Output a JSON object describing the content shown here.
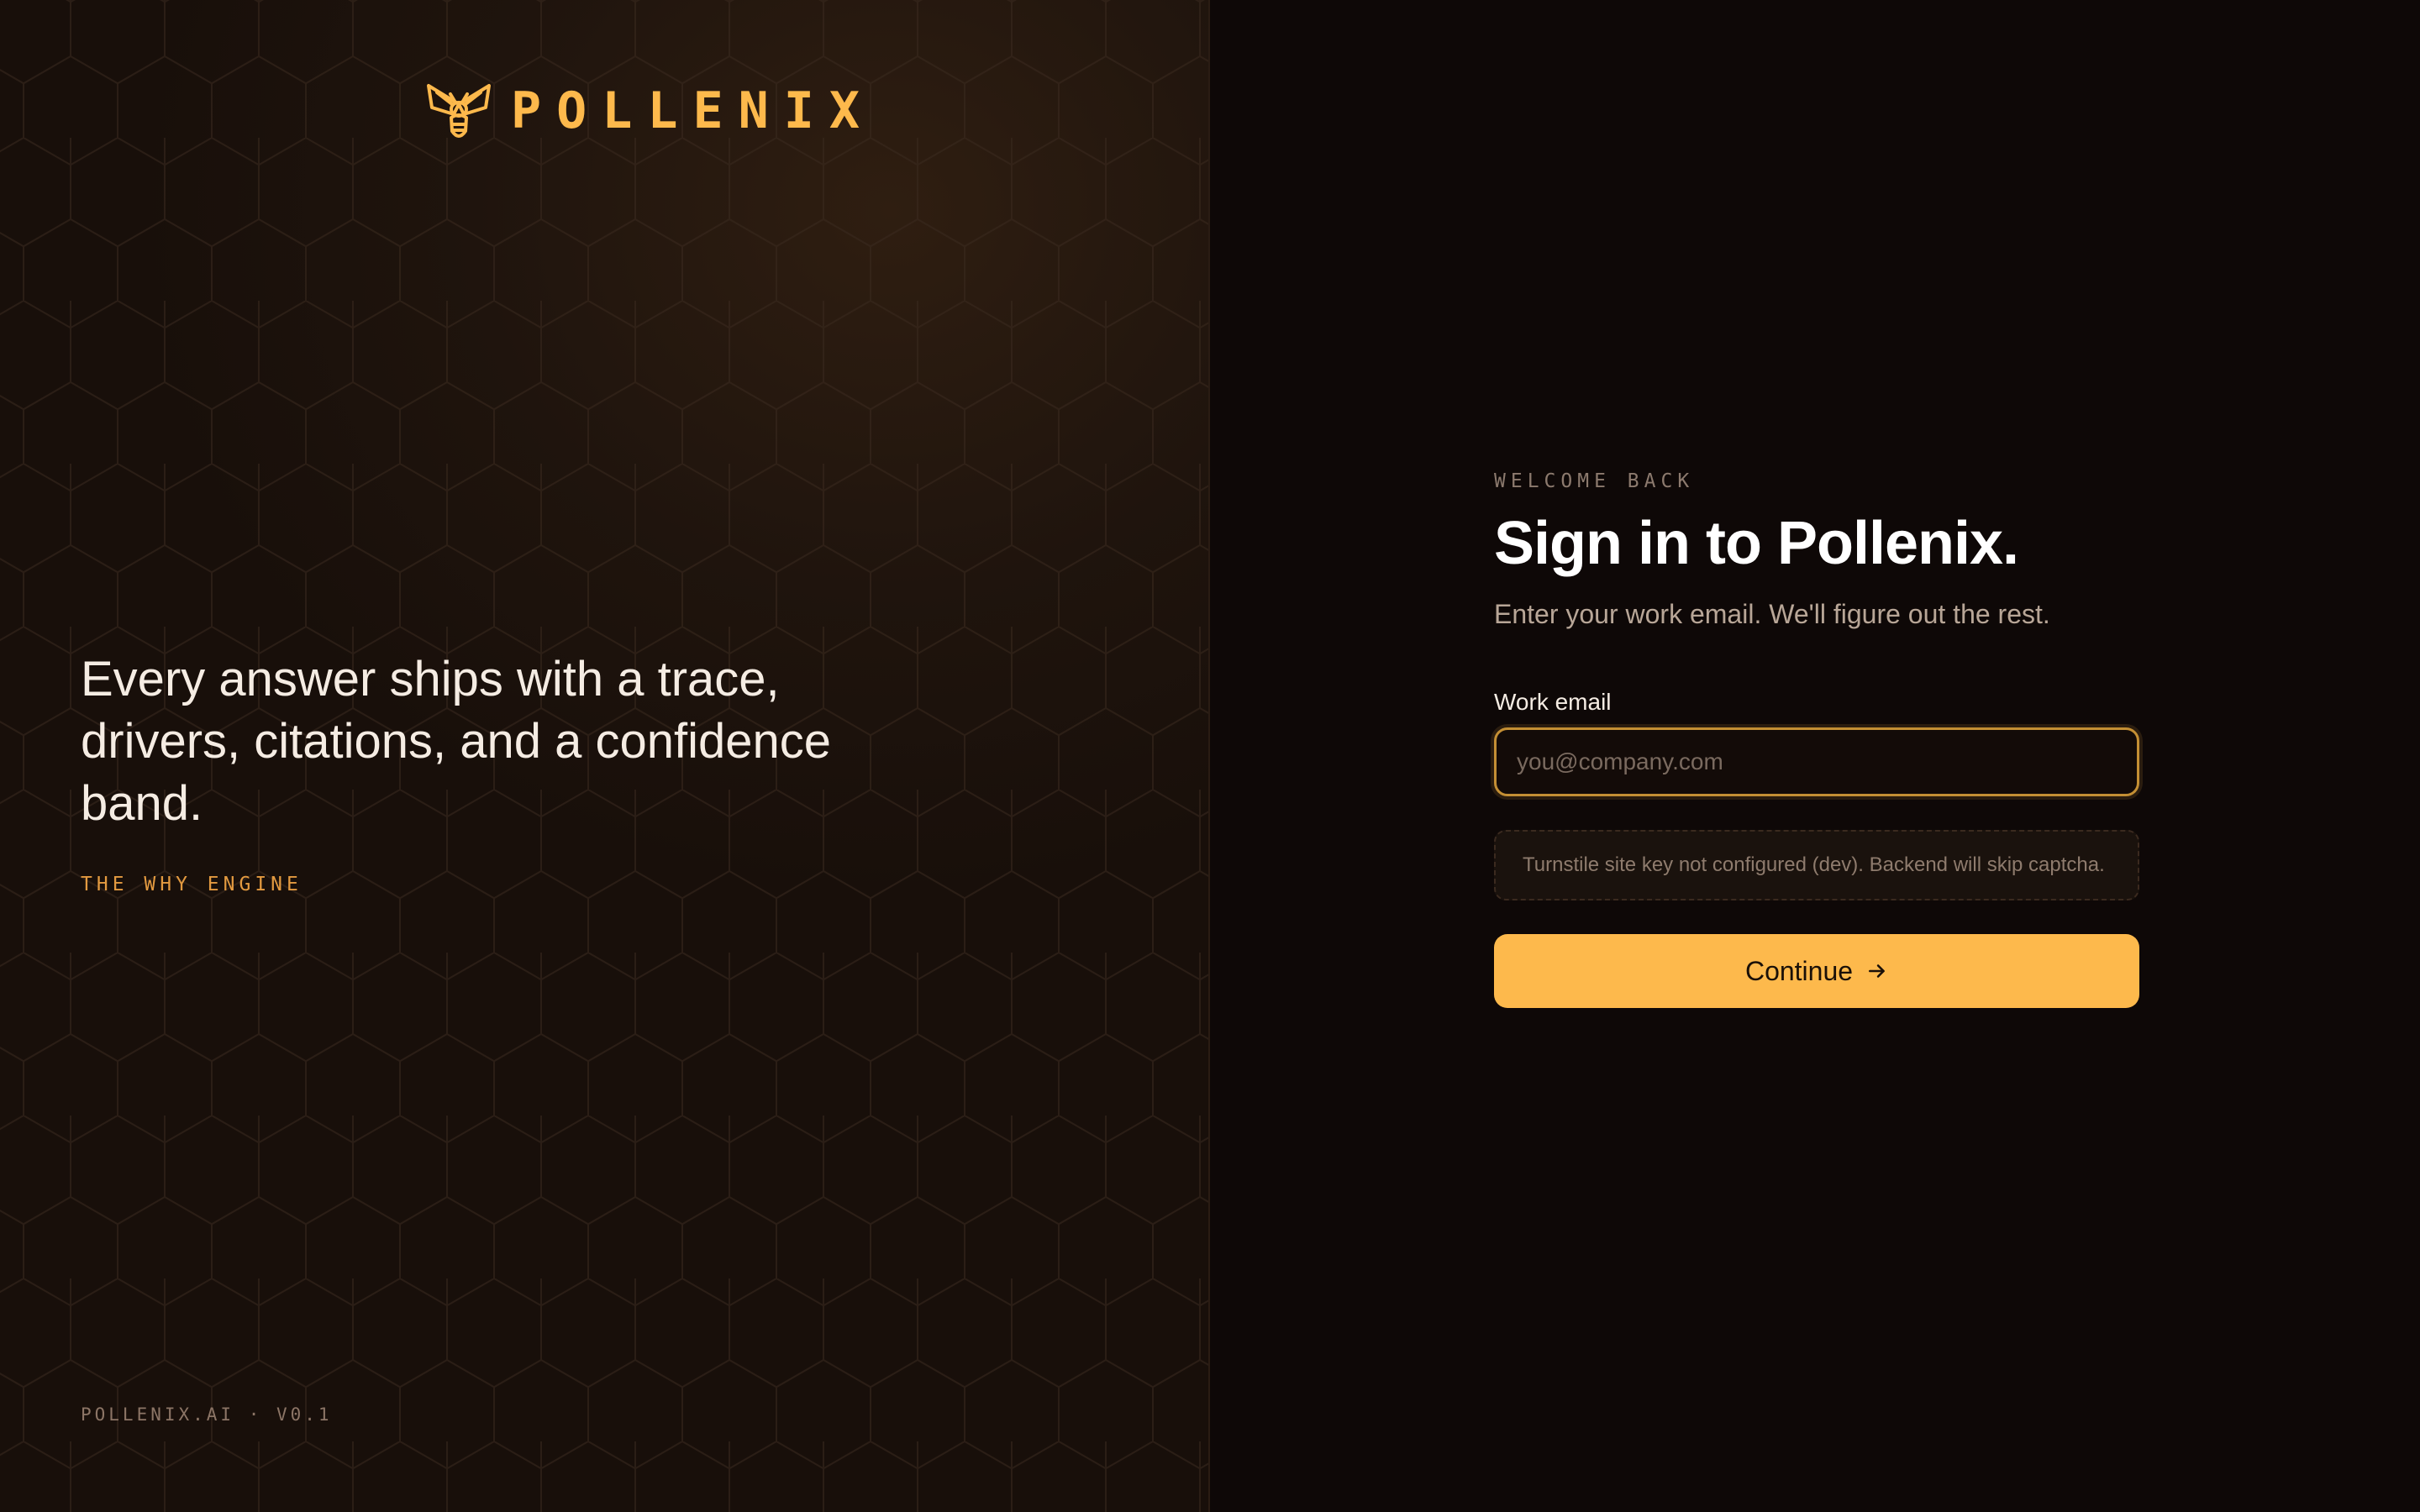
{
  "brand": {
    "name": "POLLENIX",
    "logo_icon": "bee-icon",
    "accent_color": "#fdb94c"
  },
  "hero": {
    "tagline": "Every answer ships with a trace, drivers, citations, and a confidence band.",
    "eyebrow": "THE WHY ENGINE",
    "footer": "POLLENIX.AI · V0.1"
  },
  "form": {
    "welcome": "WELCOME BACK",
    "title": "Sign in to Pollenix.",
    "subtitle": "Enter your work email. We'll figure out the rest.",
    "email_label": "Work email",
    "email_placeholder": "you@company.com",
    "email_value": "",
    "notice": "Turnstile site key not configured (dev). Backend will skip captcha.",
    "continue_label": "Continue",
    "continue_icon": "arrow-right-icon"
  }
}
